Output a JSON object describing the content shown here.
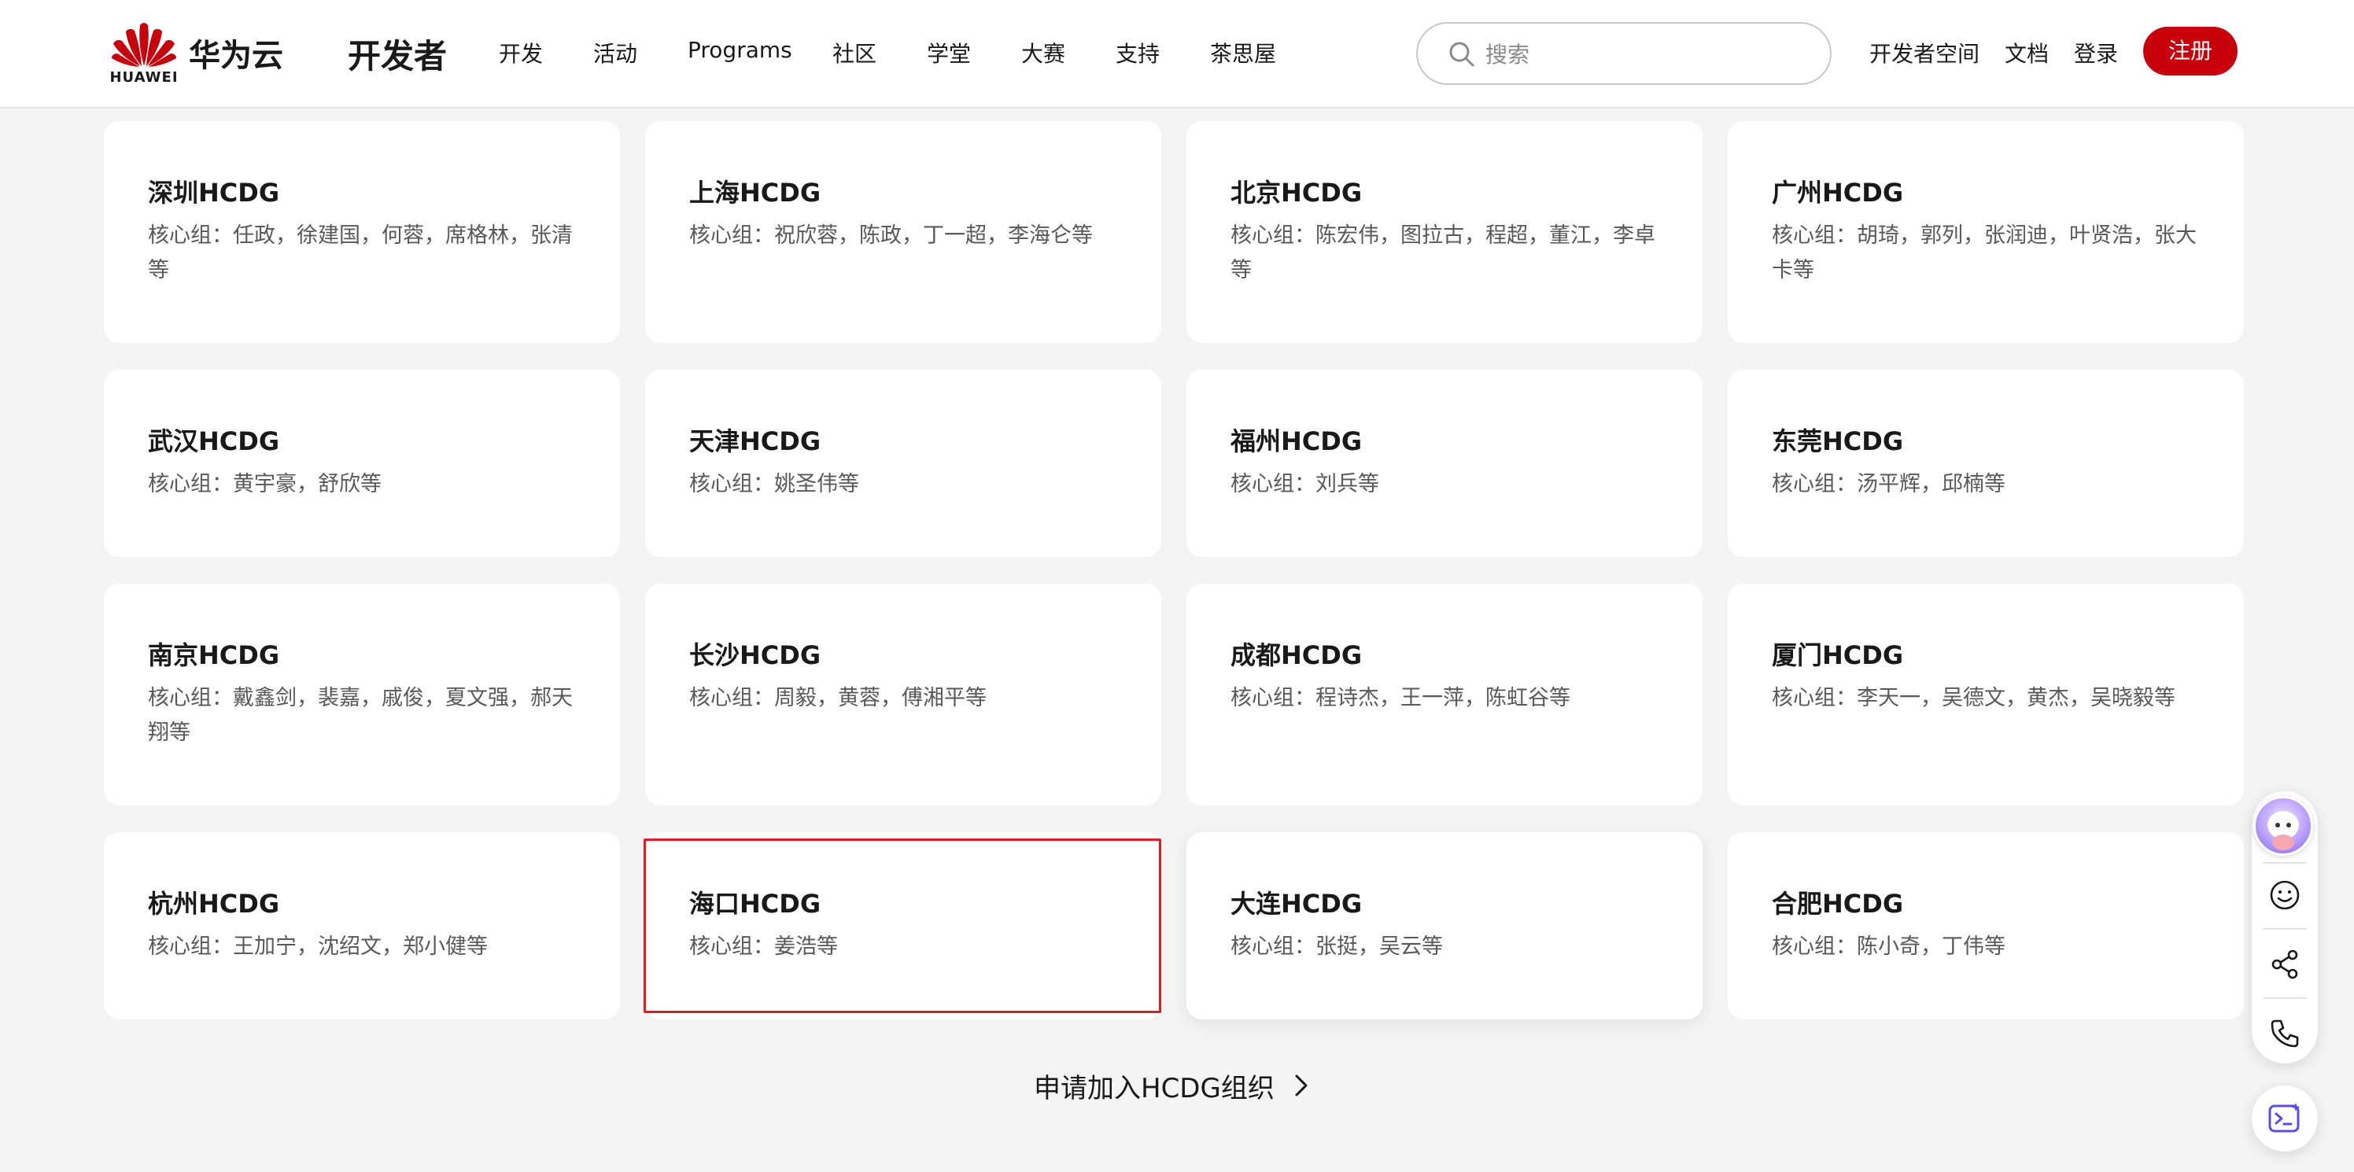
{
  "header": {
    "logo_text": "HUAWEI",
    "brand": "华为云",
    "title": "开发者",
    "nav": [
      "开发",
      "活动",
      "Programs",
      "社区",
      "学堂",
      "大赛",
      "支持",
      "茶思屋"
    ],
    "search_placeholder": "搜索",
    "right_links": [
      "开发者空间",
      "文档",
      "登录"
    ],
    "register_label": "注册",
    "brand_color": "#c7000b"
  },
  "cards": [
    {
      "title": "深圳HCDG",
      "desc": "核心组：任政，徐建国，何蓉，席格林，张清等"
    },
    {
      "title": "上海HCDG",
      "desc": "核心组：祝欣蓉，陈政，丁一超，李海仑等"
    },
    {
      "title": "北京HCDG",
      "desc": "核心组：陈宏伟，图拉古，程超，董江，李卓等"
    },
    {
      "title": "广州HCDG",
      "desc": "核心组：胡琦，郭列，张润迪，叶贤浩，张大卡等"
    },
    {
      "title": "武汉HCDG",
      "desc": "核心组：黄宇豪，舒欣等"
    },
    {
      "title": "天津HCDG",
      "desc": "核心组：姚圣伟等"
    },
    {
      "title": "福州HCDG",
      "desc": "核心组：刘兵等"
    },
    {
      "title": "东莞HCDG",
      "desc": "核心组：汤平辉，邱楠等"
    },
    {
      "title": "南京HCDG",
      "desc": "核心组：戴鑫剑，裴嘉，戚俊，夏文强，郝天翔等"
    },
    {
      "title": "长沙HCDG",
      "desc": "核心组：周毅，黄蓉，傅湘平等"
    },
    {
      "title": "成都HCDG",
      "desc": "核心组：程诗杰，王一萍，陈虹谷等"
    },
    {
      "title": "厦门HCDG",
      "desc": "核心组：李天一，吴德文，黄杰，吴晓毅等"
    },
    {
      "title": "杭州HCDG",
      "desc": "核心组：王加宁，沈绍文，郑小健等"
    },
    {
      "title": "海口HCDG",
      "desc": "核心组：姜浩等"
    },
    {
      "title": "大连HCDG",
      "desc": "核心组：张挺，吴云等"
    },
    {
      "title": "合肥HCDG",
      "desc": "核心组：陈小奇，丁伟等"
    }
  ],
  "join_label": "申请加入HCDG组织",
  "side_toolbar": {
    "icons": [
      "assistant-avatar-icon",
      "smile-icon",
      "share-icon",
      "phone-icon",
      "ai-terminal-icon"
    ]
  },
  "selection_color": "#e21c24"
}
